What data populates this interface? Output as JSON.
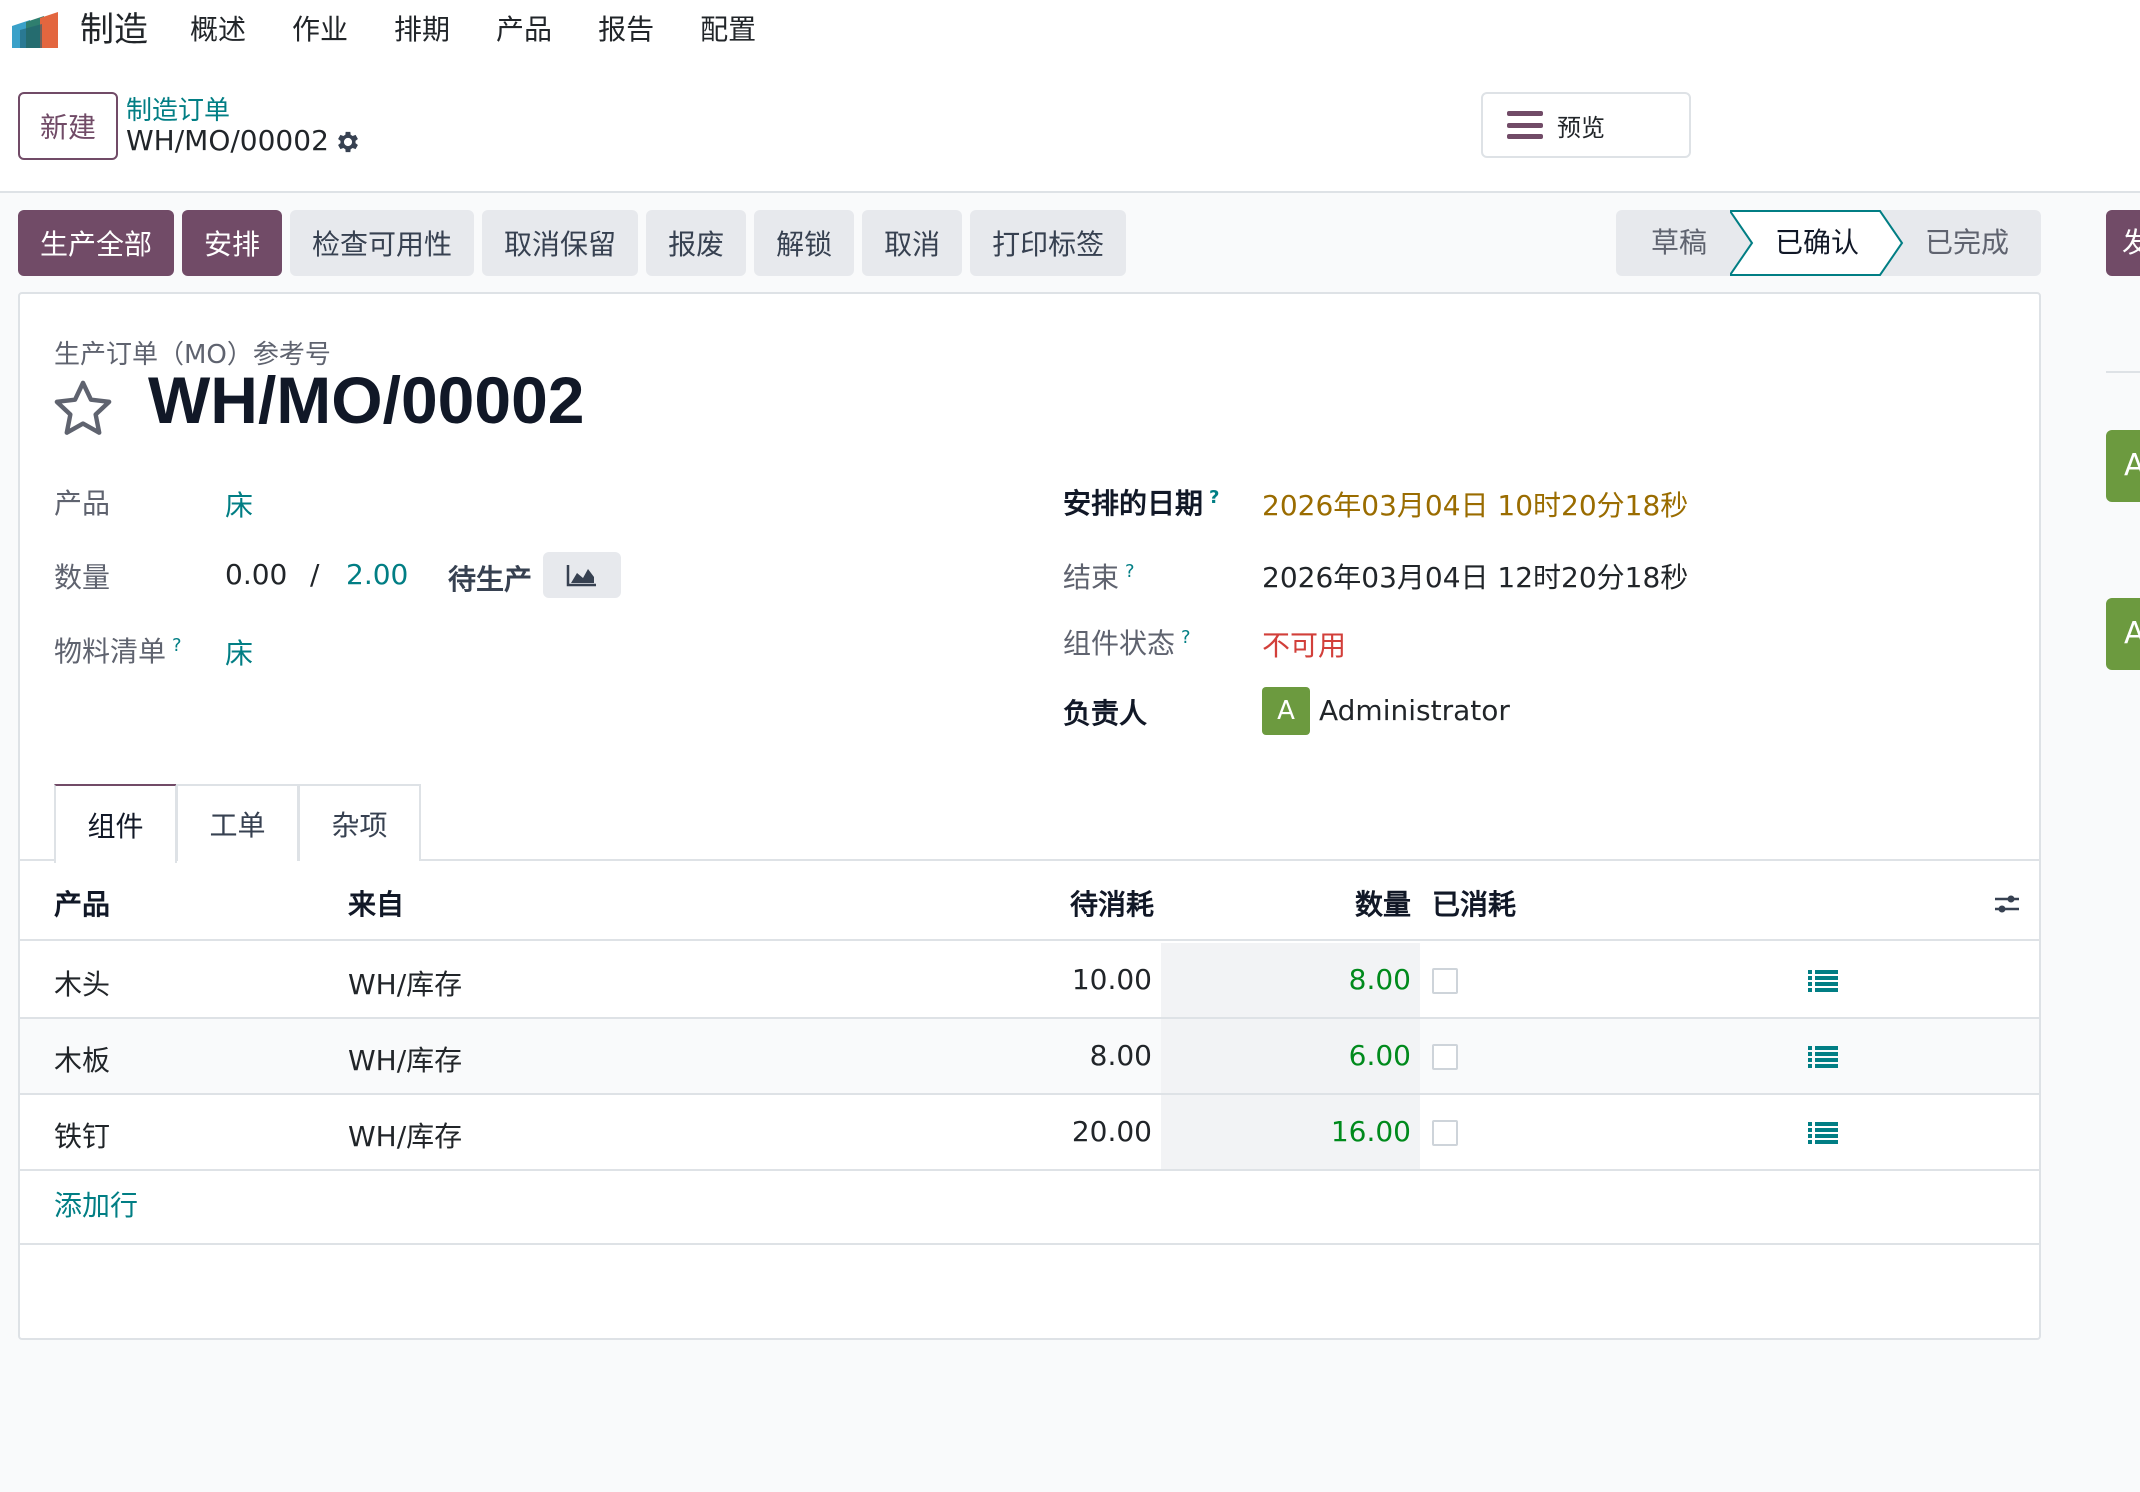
{
  "navbar": {
    "app_name": "制造",
    "menu": [
      "概述",
      "作业",
      "排期",
      "产品",
      "报告",
      "配置"
    ],
    "logo_icon": "manufacturing-app-logo"
  },
  "control_panel": {
    "new_button": "新建",
    "breadcrumb_parent": "制造订单",
    "breadcrumb_current": "WH/MO/00002",
    "preview_button": "预览"
  },
  "actions": {
    "primary": [
      "生产全部",
      "安排"
    ],
    "secondary": [
      "检查可用性",
      "取消保留",
      "报废",
      "解锁",
      "取消",
      "打印标签"
    ]
  },
  "statusbar": {
    "steps": [
      "草稿",
      "已确认",
      "已完成"
    ],
    "active": "已确认",
    "side_button_partial": "发",
    "side_avatar_partial": "A"
  },
  "form": {
    "ref_label": "生产订单（MO）参考号",
    "title": "WH/MO/00002",
    "product_label": "产品",
    "product_value": "床",
    "quantity_label": "数量",
    "quantity_produced": "0.00",
    "quantity_separator": "/",
    "quantity_planned": "2.00",
    "quantity_status": "待生产",
    "bom_label": "物料清单",
    "bom_value": "床",
    "scheduled_date_label": "安排的日期",
    "scheduled_date_value": "2026年03月04日 10时20分18秒",
    "end_label": "结束",
    "end_value": "2026年03月04日 12时20分18秒",
    "component_status_label": "组件状态",
    "component_status_value": "不可用",
    "responsible_label": "负责人",
    "responsible_initial": "A",
    "responsible_name": "Administrator",
    "help_mark": "?"
  },
  "tabs": [
    "组件",
    "工单",
    "杂项"
  ],
  "components_table": {
    "headers": [
      "产品",
      "来自",
      "待消耗",
      "数量",
      "已消耗"
    ],
    "rows": [
      {
        "product": "木头",
        "from": "WH/库存",
        "to_consume": "10.00",
        "quantity": "8.00",
        "consumed": false
      },
      {
        "product": "木板",
        "from": "WH/库存",
        "to_consume": "8.00",
        "quantity": "6.00",
        "consumed": false
      },
      {
        "product": "铁钉",
        "from": "WH/库存",
        "to_consume": "20.00",
        "quantity": "16.00",
        "consumed": false
      }
    ],
    "add_line": "添加行"
  },
  "colors": {
    "primary": "#714b67",
    "link": "#017e84",
    "warning": "#9a6c00",
    "danger": "#d23f3a",
    "success": "#008a1c",
    "avatar": "#6c9a3f"
  }
}
